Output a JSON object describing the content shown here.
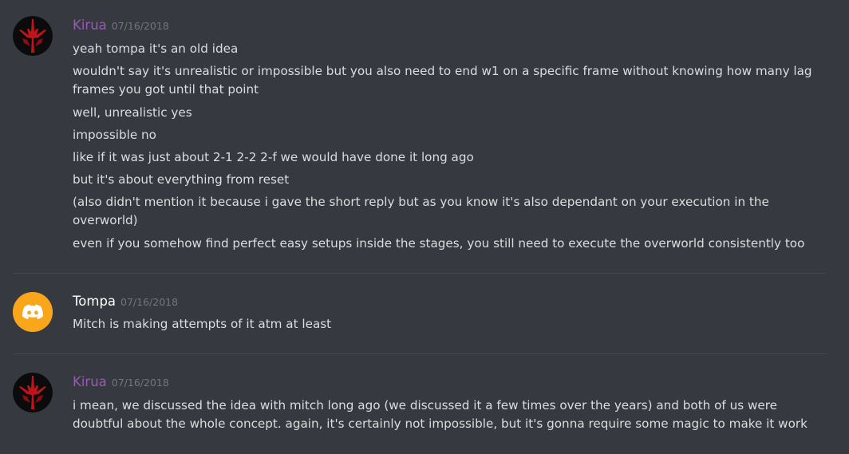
{
  "colors": {
    "background": "#36393f",
    "kirua_name": "#9b59b6",
    "tompa_name": "#ffffff",
    "timestamp": "#72767d",
    "text": "#dcddde",
    "divider": "#42454a"
  },
  "messages": [
    {
      "username": "Kirua",
      "timestamp": "07/16/2018",
      "avatar_icon": "kirua-red-emblem-icon",
      "lines": [
        "yeah tompa it's an old idea",
        "wouldn't say it's unrealistic or impossible but you also need to end w1 on a specific frame without knowing how many lag frames you got until that point",
        "well, unrealistic yes",
        "impossible no",
        "like if it was just about 2-1 2-2 2-f we would have done it long ago",
        "but it's about everything from reset",
        "(also didn't mention it because i gave the short reply but as you know it's also dependant on your execution in the overworld)",
        "even if you somehow find perfect easy setups inside the stages, you still need to execute the overworld consistently too"
      ]
    },
    {
      "username": "Tompa",
      "timestamp": "07/16/2018",
      "avatar_icon": "discord-logo-icon",
      "lines": [
        "Mitch is making attempts of it atm at least"
      ]
    },
    {
      "username": "Kirua",
      "timestamp": "07/16/2018",
      "avatar_icon": "kirua-red-emblem-icon",
      "lines": [
        "i mean, we discussed the idea with mitch long ago (we discussed it a few times over the years) and both of us were doubtful about the whole concept.  again, it's certainly not impossible, but it's gonna require some magic to make it work"
      ]
    }
  ]
}
